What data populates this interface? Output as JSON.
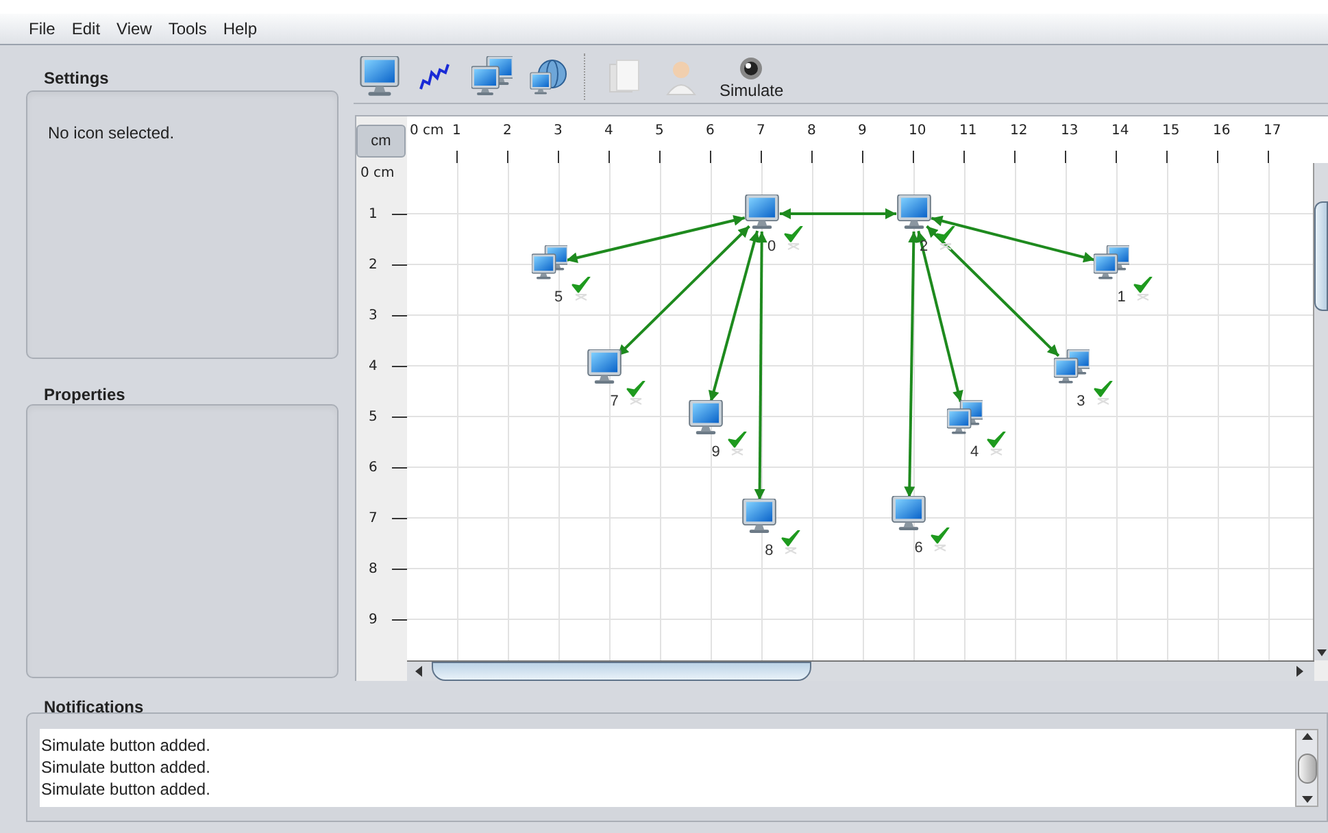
{
  "menu": [
    "File",
    "Edit",
    "View",
    "Tools",
    "Help"
  ],
  "settings": {
    "title": "Settings",
    "text": "No icon selected."
  },
  "properties": {
    "title": "Properties"
  },
  "toolbar": [
    {
      "kind": "monitor"
    },
    {
      "kind": "wave"
    },
    {
      "kind": "monitors"
    },
    {
      "kind": "globe"
    },
    {
      "kind": "separator"
    },
    {
      "kind": "papers"
    },
    {
      "kind": "person"
    },
    {
      "kind": "simulate",
      "label": "Simulate"
    }
  ],
  "ruler": {
    "corner": "cm",
    "x_labels": [
      "0 cm",
      "1",
      "2",
      "3",
      "4",
      "5",
      "6",
      "7",
      "8",
      "9",
      "10",
      "11",
      "12",
      "13",
      "14",
      "15",
      "16",
      "17"
    ],
    "y_labels": [
      "0 cm",
      "1",
      "2",
      "3",
      "4",
      "5",
      "6",
      "7",
      "8",
      "9"
    ]
  },
  "nodes": [
    {
      "label": "0",
      "kind": "single",
      "checked": true
    },
    {
      "label": "2",
      "kind": "single",
      "checked": true
    },
    {
      "label": "5",
      "kind": "multi",
      "checked": true
    },
    {
      "label": "1",
      "kind": "multi",
      "checked": true
    },
    {
      "label": "7",
      "kind": "single",
      "checked": true
    },
    {
      "label": "3",
      "kind": "multi",
      "checked": true
    },
    {
      "label": "9",
      "kind": "single",
      "checked": true
    },
    {
      "label": "4",
      "kind": "multi",
      "checked": true
    },
    {
      "label": "8",
      "kind": "single",
      "checked": true
    },
    {
      "label": "6",
      "kind": "single",
      "checked": true
    }
  ],
  "notifications": {
    "title": "Notifications",
    "lines": [
      "Simulate button added.",
      "Simulate button added.",
      "Simulate button added."
    ]
  }
}
